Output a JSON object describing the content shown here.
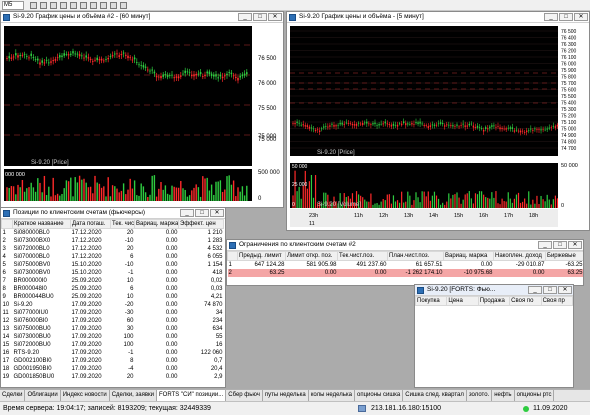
{
  "toolbar": {
    "interval": "M5"
  },
  "chart1": {
    "title": "Si-9.20 График цены и объёма #2 - [60 минут]",
    "price_ticks": [
      "76 500",
      "76 000",
      "75 500",
      "75 000"
    ],
    "vol_ticks": [
      "500 000",
      "0"
    ],
    "vol_tick_left": "000 000",
    "legend": "Si-9.20 [Price]",
    "last_price": "75 000"
  },
  "chart2": {
    "title": "Si-9.20 График цены и объёма - [5 минут]",
    "price_ticks": [
      "76 500",
      "76 400",
      "76 300",
      "76 200",
      "76 100",
      "76 000",
      "75 900",
      "75 800",
      "75 700",
      "75 600",
      "75 500",
      "75 400",
      "75 300",
      "75 200",
      "75 100",
      "75 000",
      "74 900",
      "74 800",
      "74 700"
    ],
    "vol_ticks": [
      "50 000",
      "0"
    ],
    "vol_ticks_left": [
      "50 000",
      "25 000",
      "0"
    ],
    "legend": "Si-9.20 [Price]",
    "vol_legend": "Si-9.20 [Volume]",
    "time_labels": [
      "23h",
      "11h",
      "12h",
      "13h",
      "14h",
      "15h",
      "16h",
      "17h",
      "18h"
    ],
    "date_label": "11"
  },
  "positions": {
    "title": "Позиции по клиентским счетам (фьючерсы)",
    "columns": [
      "",
      "Краткое название",
      "Дата погаш.",
      "Тек. чист.",
      "Вариац. маржа",
      "Эффект. цен"
    ],
    "rows": [
      [
        "1",
        "Si080000BL0",
        "17.12.2020",
        "20",
        "0.00",
        "1 210"
      ],
      [
        "2",
        "Si073000BX0",
        "17.12.2020",
        "-10",
        "0.00",
        "1 283"
      ],
      [
        "3",
        "Si072000BL0",
        "17.12.2020",
        "20",
        "0.00",
        "4 532"
      ],
      [
        "4",
        "Si070000BL0",
        "17.12.2020",
        "6",
        "0.00",
        "6 055"
      ],
      [
        "5",
        "Si075000BV0",
        "15.10.2020",
        "-10",
        "0.00",
        "1 154"
      ],
      [
        "6",
        "Si073000BV0",
        "15.10.2020",
        "-1",
        "0.00",
        "418"
      ],
      [
        "7",
        "BR000000I0",
        "25.09.2020",
        "10",
        "0.00",
        "0,02"
      ],
      [
        "8",
        "BR000048I0",
        "25.09.2020",
        "6",
        "0.00",
        "0,03"
      ],
      [
        "9",
        "BR000044BU0",
        "25.09.2020",
        "10",
        "0.00",
        "4,21"
      ],
      [
        "10",
        "Si-9.20",
        "17.09.2020",
        "-20",
        "0.00",
        "74 870"
      ],
      [
        "11",
        "Si077000IU0",
        "17.09.2020",
        "-30",
        "0.00",
        "34"
      ],
      [
        "12",
        "Si076000BI0",
        "17.09.2020",
        "60",
        "0.00",
        "234"
      ],
      [
        "13",
        "Si075000BU0",
        "17.09.2020",
        "30",
        "0.00",
        "634"
      ],
      [
        "14",
        "Si073000BU0",
        "17.09.2020",
        "100",
        "0.00",
        "55"
      ],
      [
        "15",
        "Si072000BU0",
        "17.09.2020",
        "100",
        "0.00",
        "16"
      ],
      [
        "16",
        "RTS-9.20",
        "17.09.2020",
        "-1",
        "0.00",
        "122 060"
      ],
      [
        "17",
        "GD002100BI0",
        "17.09.2020",
        "8",
        "0.00",
        "0,7"
      ],
      [
        "18",
        "GD001950BI0",
        "17.09.2020",
        "-4",
        "0.00",
        "20,4"
      ],
      [
        "19",
        "GD001850BU0",
        "17.09.2020",
        "20",
        "0.00",
        "2,9"
      ]
    ]
  },
  "limits": {
    "title": "Ограничения по клиентским счетам #2",
    "columns": [
      "",
      "Предыд. лимит",
      "Лимит откр. поз.",
      "Тек.чист.поз.",
      "План.чист.поз.",
      "Вариац. маржа",
      "Накоплен. доход",
      "Биржевые"
    ],
    "rows": [
      [
        "1",
        "647 124.28",
        "581 905.98",
        "491 237.60",
        "61 657.51",
        "0.00",
        "-29 010.87",
        "-63.25"
      ],
      [
        "2",
        "63.25",
        "0.00",
        "0.00",
        "-1 262 174.10",
        "-10 975.68",
        "0.00",
        "63.25"
      ]
    ]
  },
  "quote": {
    "title": "Si-9.20 [FORTS: Фью...",
    "columns": [
      "Покупка",
      "Цена",
      "Продажа",
      "Своя по",
      "Своя пр"
    ]
  },
  "taskbar": [
    "Сделки",
    "Облигации",
    "Индекс новости",
    "Сделки, заявки",
    "FORTS \"СИ\" позиции...",
    "Сбер фьюч",
    "путы неделька",
    "колы неделька",
    "опционы сишка",
    "Сишка след. квартал",
    "золото.",
    "нефть",
    "опционы ртс"
  ],
  "status": {
    "server_time": "Время сервера: 19:04:17; записей: 8193209; текущая: 32449339",
    "ip": "213.181.16.180:15100",
    "date": "11.09.2020"
  },
  "colors": {
    "bull": "#2ecc40",
    "bear": "#ff2a2a",
    "chart_bg": "#000000",
    "limit_row_bg": "#f4a5a5",
    "title_blue": "#e8eef8"
  }
}
